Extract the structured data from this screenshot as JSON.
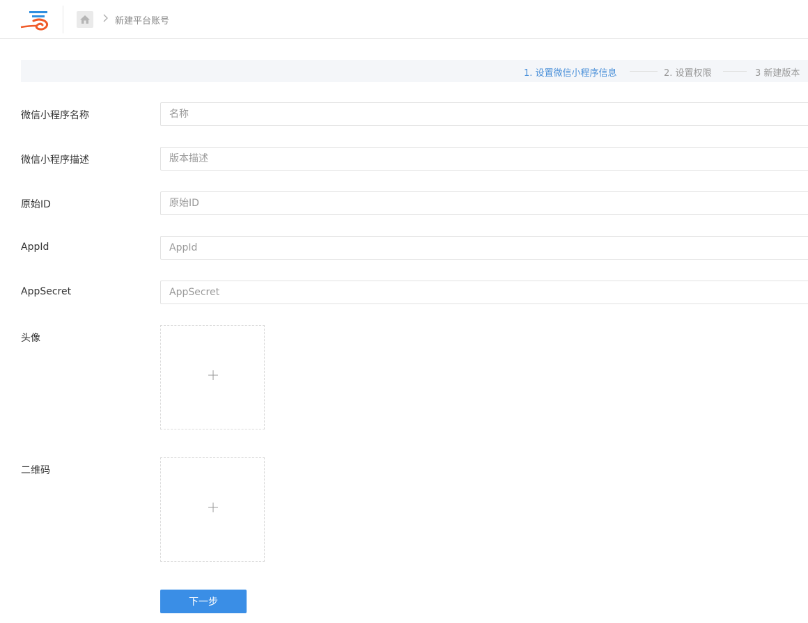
{
  "breadcrumb": {
    "current": "新建平台账号"
  },
  "steps": [
    {
      "label": "1. 设置微信小程序信息",
      "active": true
    },
    {
      "label": "2. 设置权限",
      "active": false
    },
    {
      "label": "3 新建版本",
      "active": false
    }
  ],
  "form": {
    "name": {
      "label": "微信小程序名称",
      "placeholder": "名称",
      "value": ""
    },
    "description": {
      "label": "微信小程序描述",
      "placeholder": "版本描述",
      "value": ""
    },
    "original_id": {
      "label": "原始ID",
      "placeholder": "原始ID",
      "value": ""
    },
    "app_id": {
      "label": "AppId",
      "placeholder": "AppId",
      "value": ""
    },
    "app_secret": {
      "label": "AppSecret",
      "placeholder": "AppSecret",
      "value": ""
    },
    "avatar": {
      "label": "头像"
    },
    "qrcode": {
      "label": "二维码"
    }
  },
  "actions": {
    "next_label": "下一步"
  },
  "colors": {
    "accent": "#3a8ee6",
    "active_step": "#4a90d9",
    "logo_orange": "#f05a28",
    "logo_blue": "#2f8fe0"
  },
  "icons": {
    "logo": "cloud-logo-icon",
    "home": "home-icon",
    "separator": "chevron-right-icon",
    "upload": "plus-icon"
  }
}
